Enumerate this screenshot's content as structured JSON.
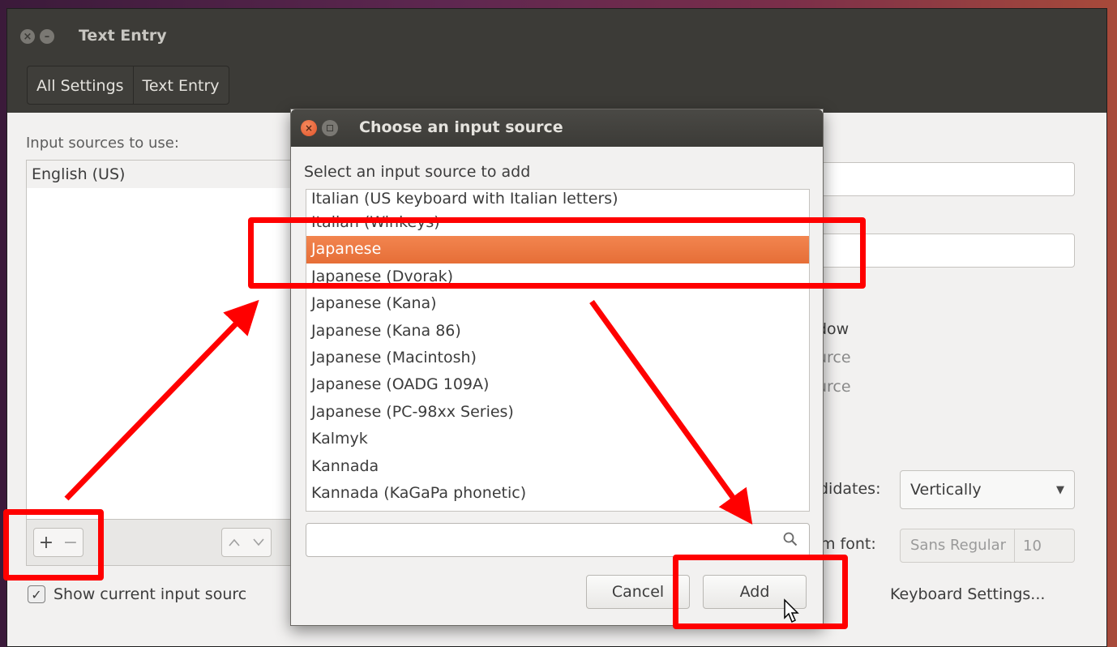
{
  "main_window": {
    "title": "Text Entry",
    "breadcrumbs": [
      "All Settings",
      "Text Entry"
    ],
    "input_sources_label": "Input sources to use:",
    "input_sources": [
      "English (US)"
    ],
    "show_current_checkbox": {
      "label": "Show current input sourc",
      "checked": true
    },
    "right_partial_texts": [
      "dow",
      "urce",
      "urce"
    ],
    "candidates_label": "didates:",
    "candidates_value": "Vertically",
    "font_label": "m font:",
    "font_name": "Sans Regular",
    "font_size": "10",
    "keyboard_settings_link": "Keyboard Settings..."
  },
  "dialog": {
    "title": "Choose an input source",
    "prompt": "Select an input source to add",
    "items": [
      "Italian (US keyboard with Italian letters)",
      "Italian (Winkeys)",
      "Japanese",
      "Japanese (Dvorak)",
      "Japanese (Kana)",
      "Japanese (Kana 86)",
      "Japanese (Macintosh)",
      "Japanese (OADG 109A)",
      "Japanese (PC-98xx Series)",
      "Kalmyk",
      "Kannada",
      "Kannada (KaGaPa phonetic)"
    ],
    "selected_index": 2,
    "search_value": "",
    "cancel_label": "Cancel",
    "add_label": "Add"
  },
  "colors": {
    "selection": "#e66e37",
    "annotation": "#ff0000",
    "titlebar": "#3c3b37"
  }
}
